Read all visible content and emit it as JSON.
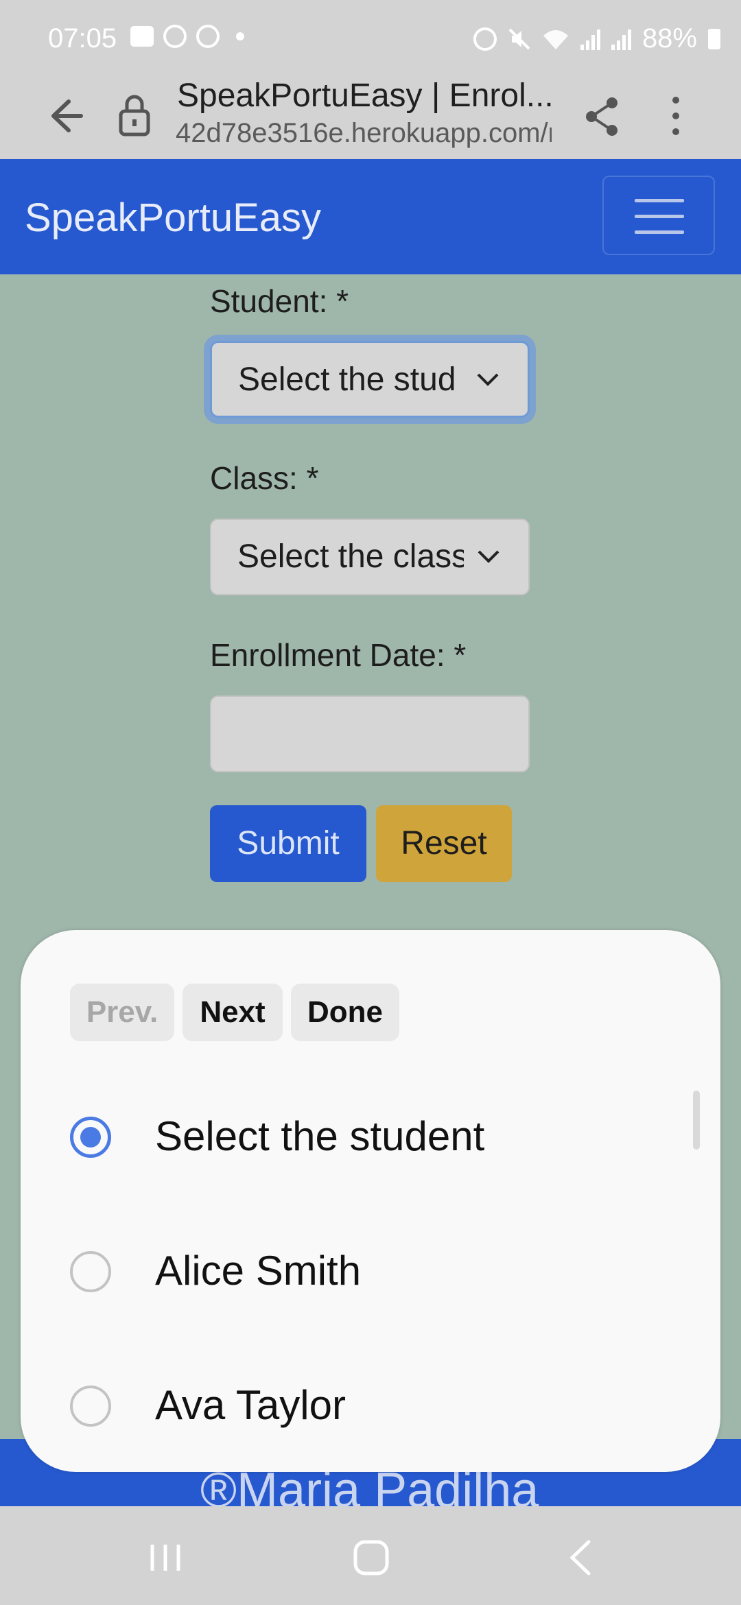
{
  "status_bar": {
    "time": "07:05",
    "battery": "88%",
    "icons": [
      "gallery-icon",
      "alarm-icon",
      "whatsapp-icon",
      "dot-icon",
      "alarm-icon",
      "mute-icon",
      "wifi-icon",
      "signal-icon",
      "signal-roaming-icon",
      "battery-icon"
    ]
  },
  "browser": {
    "title": "SpeakPortuEasy | Enrol...",
    "url": "42d78e3516e.herokuapp.com/r"
  },
  "navbar": {
    "brand": "SpeakPortuEasy"
  },
  "form": {
    "student_label": "Student: *",
    "student_value": "Select the stud",
    "class_label": "Class: *",
    "class_value": "Select the class",
    "date_label": "Enrollment Date: *",
    "date_value": "",
    "submit_label": "Submit",
    "reset_label": "Reset"
  },
  "footer": {
    "text": "®Maria Padilha"
  },
  "picker": {
    "prev_label": "Prev.",
    "next_label": "Next",
    "done_label": "Done",
    "options": [
      {
        "label": "Select the student",
        "selected": true
      },
      {
        "label": "Alice Smith",
        "selected": false
      },
      {
        "label": "Ava Taylor",
        "selected": false
      }
    ]
  },
  "colors": {
    "primary": "#2659cf",
    "warning": "#cfa43a",
    "page_bg": "#9fb6aa",
    "radio_accent": "#4a7ae3"
  }
}
